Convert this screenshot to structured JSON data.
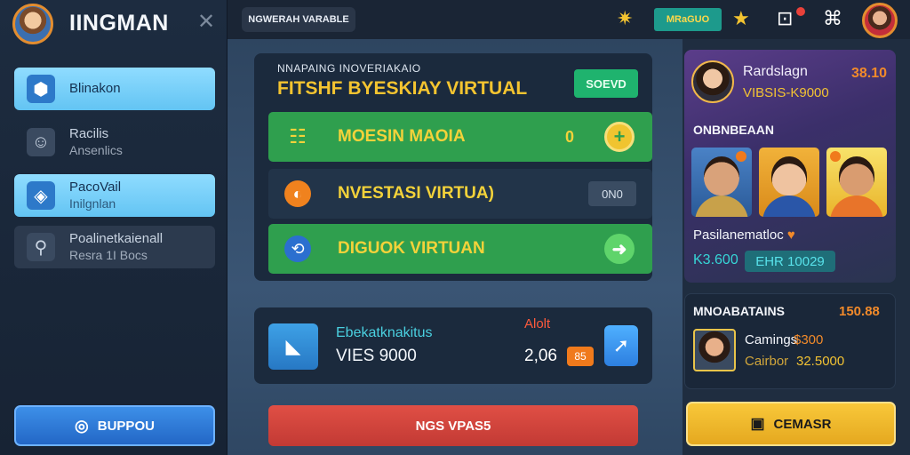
{
  "sidebar": {
    "app_title": "IINGMAN",
    "items": [
      {
        "label": "Blinakon",
        "sub": "",
        "icon": "box-icon"
      },
      {
        "label": "Racilis",
        "sub": "Ansenlics",
        "icon": "person-icon"
      },
      {
        "label": "PacoVail",
        "sub": "Inilgnlan",
        "icon": "package-icon"
      },
      {
        "label": "Poalinetkaienall",
        "sub": "Resra 1I Bocs",
        "icon": "link-icon"
      }
    ],
    "support_label": "BUPPOU"
  },
  "topbar": {
    "chip_label": "NGWERAH VARABLE",
    "badge_label": "MRaGUO"
  },
  "main": {
    "card_subtitle": "NNAPAING INOVERIAKAIO",
    "card_title": "FITSHF BYESKIAY VIRTUAL",
    "sound_button": "SOEVD",
    "rows": [
      {
        "label": "MOESIN MAOIA",
        "value": "0",
        "icon": "list-icon"
      },
      {
        "label": "NVESTASI VIRTUA)",
        "value": "0N0",
        "icon": "orange-coin-icon"
      },
      {
        "label": "DIGUOK VIRTUAN",
        "value": "",
        "icon": "rotate-icon"
      }
    ],
    "stats": {
      "label": "Ebekatknakitus",
      "value": "VIES 9000",
      "alert": "Alolt",
      "number": "2,06",
      "chip": "85"
    },
    "bottom_button": "NGS VPAS5"
  },
  "right": {
    "profile": {
      "name": "Rardslagn",
      "sub": "VIBSIS-K9000",
      "amount": "38.10"
    },
    "section_title": "ONBNBEAAN",
    "tagline": "Pasilanematloc",
    "heart": "♥",
    "value1": "K3.600",
    "value2": "EHR 10029",
    "earnings": {
      "title": "MNOABATAINS",
      "amount": "150.88",
      "line1_label": "Camings",
      "line1_value": "$300",
      "line2_label": "Cairbor",
      "line2_value": "32.5000"
    },
    "gold_button": "CEMASR"
  }
}
